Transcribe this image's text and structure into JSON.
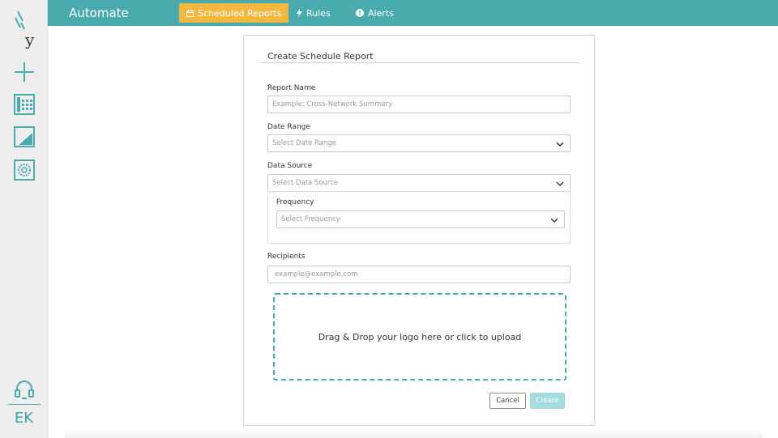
{
  "app": {
    "title": "Automate"
  },
  "nav": {
    "tabs": [
      {
        "label": "Scheduled Reports",
        "icon": "calendar-icon",
        "active": true
      },
      {
        "label": "Rules",
        "icon": "bolt-icon",
        "active": false
      },
      {
        "label": "Alerts",
        "icon": "alert-circle-icon",
        "active": false
      }
    ]
  },
  "sidebar": {
    "items": [
      {
        "icon": "add-icon"
      },
      {
        "icon": "calendar-grid-icon"
      },
      {
        "icon": "chart-icon"
      },
      {
        "icon": "settings-icon"
      }
    ],
    "support_icon": "headset-icon",
    "avatar_initials": "EK"
  },
  "form": {
    "title": "Create Schedule Report",
    "report_name": {
      "label": "Report Name",
      "placeholder": "Example: Cross-Network Summary"
    },
    "date_range": {
      "label": "Date Range",
      "value": "Select Date Range"
    },
    "data_source": {
      "label": "Data Source",
      "value": "Select Data Source"
    },
    "frequency": {
      "label": "Frequency",
      "value": "Select Frequency"
    },
    "recipients": {
      "label": "Recipients",
      "placeholder": "example@example.com"
    },
    "upload_text": "Drag & Drop your logo here or click to upload",
    "cancel_label": "Cancel",
    "create_label": "Create"
  },
  "colors": {
    "accent": "#4aabaf",
    "active_tab": "#f3b83f",
    "create_disabled": "#a5dcdf"
  }
}
